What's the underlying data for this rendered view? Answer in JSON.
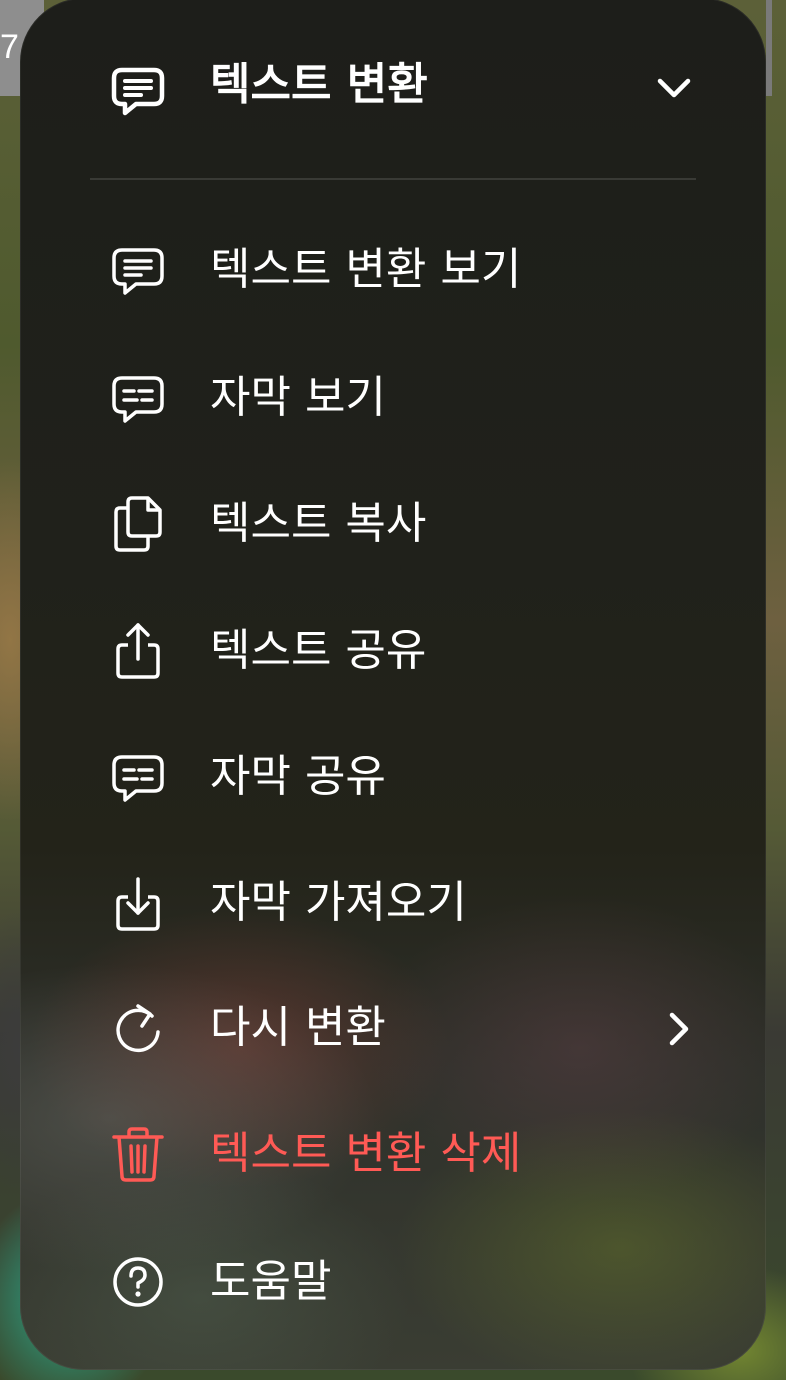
{
  "background": {
    "top_left_text": "7"
  },
  "menu": {
    "header": {
      "title": "텍스트 변환",
      "icon": "speech-bubble-text-icon",
      "chevron": "chevron-down-icon"
    },
    "items": [
      {
        "label": "텍스트 변환 보기",
        "icon": "speech-bubble-text-icon"
      },
      {
        "label": "자막 보기",
        "icon": "captions-bubble-icon"
      },
      {
        "label": "텍스트 복사",
        "icon": "copy-documents-icon"
      },
      {
        "label": "텍스트 공유",
        "icon": "share-icon"
      },
      {
        "label": "자막 공유",
        "icon": "captions-bubble-icon"
      },
      {
        "label": "자막 가져오기",
        "icon": "import-icon"
      },
      {
        "label": "다시 변환",
        "icon": "refresh-icon",
        "submenu": "chevron-right-icon"
      },
      {
        "label": "텍스트 변환 삭제",
        "icon": "trash-icon",
        "destructive": true,
        "color": "#ff5a55"
      },
      {
        "label": "도움말",
        "icon": "help-circle-icon"
      }
    ]
  }
}
